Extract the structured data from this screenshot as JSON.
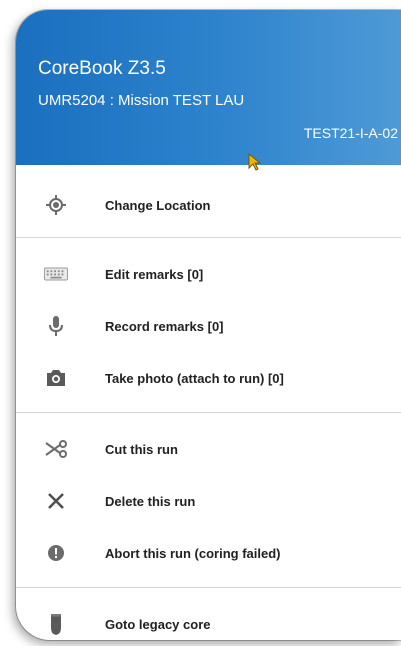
{
  "header": {
    "app_title": "CoreBook Z3.5",
    "mission": "UMR5204 : Mission TEST LAU",
    "run_code": "TEST21-I-A-02"
  },
  "colors": {
    "header_start": "#1a6fbf",
    "header_end": "#4f9ad6",
    "icon": "#6b6b6b",
    "label": "#212121",
    "divider": "#d6d6d6"
  },
  "menu": {
    "location": [
      {
        "label": "Change Location",
        "icon": "location-icon"
      }
    ],
    "remarks": [
      {
        "label": "Edit remarks [0]",
        "icon": "keyboard-icon"
      },
      {
        "label": "Record remarks [0]",
        "icon": "microphone-icon"
      },
      {
        "label": "Take photo (attach to run) [0]",
        "icon": "camera-icon"
      }
    ],
    "run_actions": [
      {
        "label": "Cut this run",
        "icon": "scissors-icon"
      },
      {
        "label": "Delete this run",
        "icon": "close-icon"
      },
      {
        "label": "Abort this run (coring failed)",
        "icon": "alert-icon"
      }
    ],
    "legacy": [
      {
        "label": "Goto legacy core",
        "icon": "core-icon"
      }
    ]
  }
}
